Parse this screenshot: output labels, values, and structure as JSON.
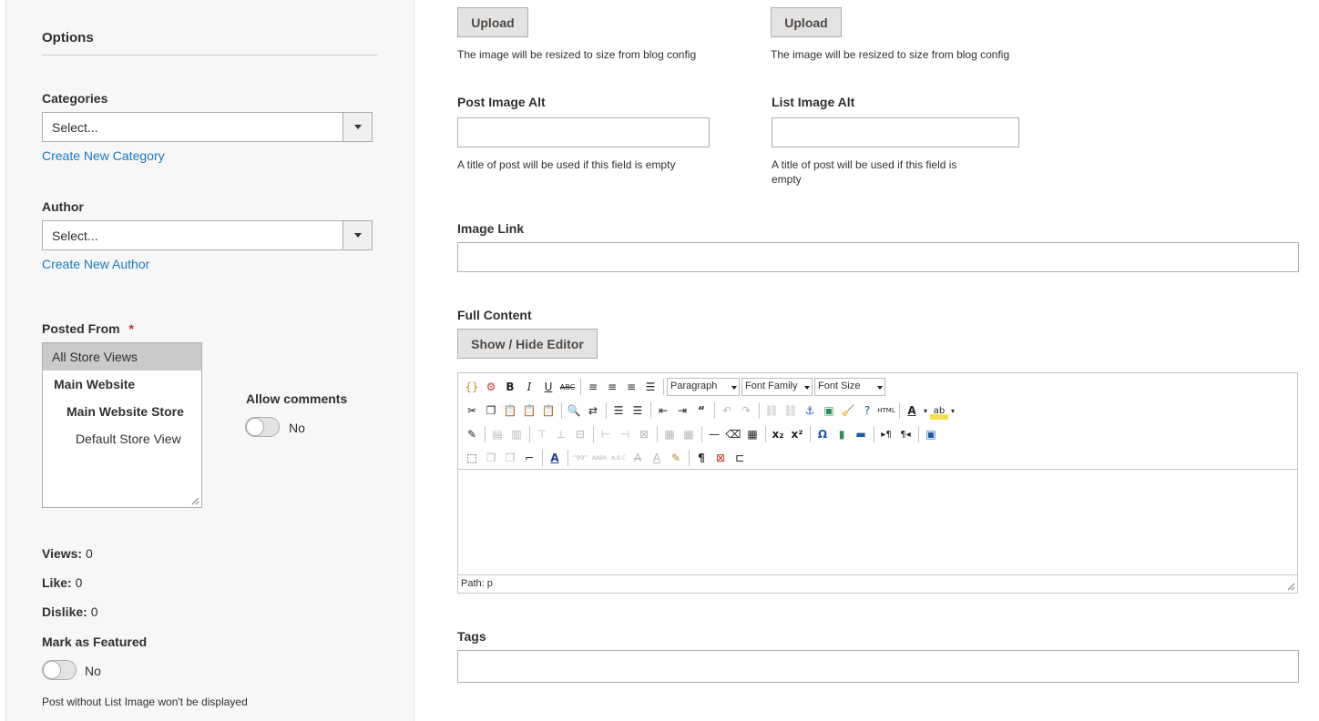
{
  "sidebar": {
    "section_title": "Options",
    "categories": {
      "label": "Categories",
      "value": "Select...",
      "create_link": "Create New Category"
    },
    "author": {
      "label": "Author",
      "value": "Select...",
      "create_link": "Create New Author"
    },
    "posted_from": {
      "label": "Posted From",
      "required_mark": "*",
      "options": [
        "All Store Views",
        "Main Website",
        "Main Website Store",
        "Default Store View"
      ],
      "selected": "All Store Views"
    },
    "allow_comments": {
      "label": "Allow comments",
      "value": "No"
    },
    "views": {
      "label": "Views:",
      "value": "0"
    },
    "like": {
      "label": "Like:",
      "value": "0"
    },
    "dislike": {
      "label": "Dislike:",
      "value": "0"
    },
    "featured": {
      "label": "Mark as Featured",
      "value": "No",
      "note": "Post without List Image won't be displayed"
    }
  },
  "main": {
    "post_image": {
      "upload_label": "Upload",
      "hint": "The image will be resized to size from blog config"
    },
    "list_image": {
      "upload_label": "Upload",
      "hint": "The image will be resized to size from blog config"
    },
    "post_image_alt": {
      "label": "Post Image Alt",
      "value": "",
      "hint": "A title of post will be used if this field is empty"
    },
    "list_image_alt": {
      "label": "List Image Alt",
      "value": "",
      "hint_line1": "A title of post will be used if this field is",
      "hint_line2": "empty"
    },
    "image_link": {
      "label": "Image Link",
      "value": ""
    },
    "full_content": {
      "label": "Full Content",
      "toggle_editor": "Show / Hide Editor",
      "toolbar": {
        "format": "Paragraph",
        "font_family": "Font Family",
        "font_size": "Font Size"
      },
      "path": "Path: p"
    },
    "tags": {
      "label": "Tags",
      "value": ""
    }
  },
  "colors": {
    "link": "#1979c3",
    "required": "#e22626",
    "button_bg": "#e3e3e3",
    "border": "#adadad",
    "sidebar_bg": "#f7f7f7"
  }
}
